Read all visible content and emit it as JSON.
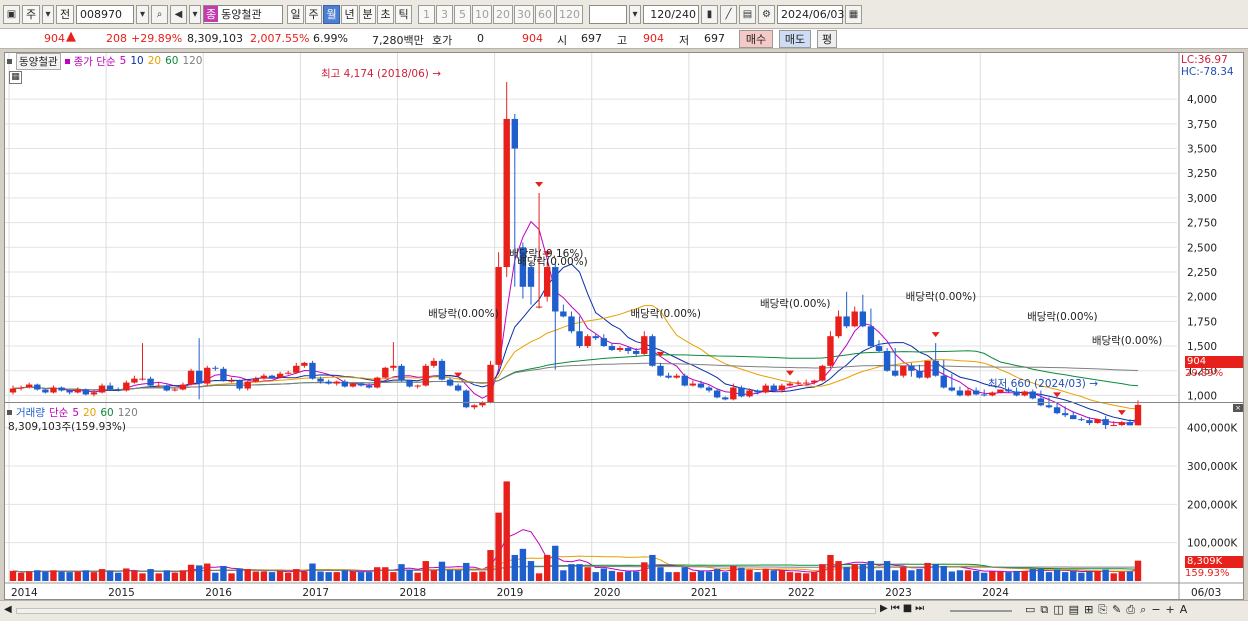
{
  "toolbar": {
    "type_label": "주",
    "prev_label": "전",
    "code": "008970",
    "stock_badge": "종",
    "stock_name": "동양철관",
    "periods": [
      "일",
      "주",
      "월",
      "년",
      "분",
      "초",
      "틱"
    ],
    "active_period": "월",
    "ticks": [
      "1",
      "3",
      "5",
      "10",
      "20",
      "30",
      "60",
      "120"
    ],
    "count": "120",
    "count_total": "/240",
    "date": "2024/06/03"
  },
  "quote": {
    "price": "904",
    "change": "208",
    "change_pct": "+29.89%",
    "volume": "8,309,103",
    "volume_pct": "2,007.55%",
    "turnover": "6.99%",
    "amount": "7,280백만",
    "hoga_label": "호가",
    "hoga_value": "0",
    "hoga_price": "904",
    "open_label": "시",
    "open": "697",
    "high_label": "고",
    "high": "904",
    "low_label": "저",
    "low": "697",
    "buy_label": "매수",
    "sell_label": "매도",
    "eval_label": "평"
  },
  "colors": {
    "up": "#e8201b",
    "down": "#1f5fcd",
    "ma5": "#c000c0",
    "ma10": "#0a2ea8",
    "ma20": "#e8a000",
    "ma60": "#0d8a3a",
    "ma120": "#808080"
  },
  "price_panel": {
    "stock_name": "동양철관",
    "legend_prefix": "종가 단순",
    "ma_labels": [
      "5",
      "10",
      "20",
      "60",
      "120"
    ],
    "lc": "LC:36.97",
    "hc": "HC:-78.34",
    "high_note": "최고 4,174 (2018/06)",
    "low_note": "최저 660 (2024/03)",
    "dividend_notes": [
      "배당락(0.00%)",
      "배당락(-9.16%)",
      "배당락(0.00%)",
      "배당락(0.00%)",
      "배당락(0.00%)",
      "배당락(0.00%)",
      "배당락(0.00%)",
      "배당락(0.00%)"
    ],
    "y_ticks": [
      "4,000",
      "3,750",
      "3,500",
      "3,250",
      "3,000",
      "2,750",
      "2,500",
      "2,250",
      "2,000",
      "1,750",
      "1,500",
      "1,250",
      "1,000"
    ],
    "cur_price": "904",
    "cur_pct": "29.89%"
  },
  "volume_panel": {
    "legend_label": "거래량",
    "legend_prefix": "단순",
    "ma_labels": [
      "5",
      "20",
      "60",
      "120"
    ],
    "current": "8,309,103주(159.93%)",
    "y_ticks": [
      "400,000K",
      "300,000K",
      "200,000K",
      "100,000K"
    ],
    "cur_vol": "8,309K",
    "cur_pct": "159.93%"
  },
  "x_axis": [
    "2014",
    "2015",
    "2016",
    "2017",
    "2018",
    "2019",
    "2020",
    "2021",
    "2022",
    "2023",
    "2024",
    "06/03"
  ],
  "chart_data": {
    "type": "candlestick",
    "x_start": "2014/01",
    "interval": "month",
    "open": [
      1030,
      1070,
      1080,
      1110,
      1060,
      1030,
      1080,
      1050,
      1030,
      1060,
      1010,
      1030,
      1100,
      1060,
      1050,
      1130,
      1170,
      1170,
      1100,
      1100,
      1050,
      1060,
      1110,
      1250,
      1120,
      1280,
      1270,
      1150,
      1150,
      1070,
      1140,
      1170,
      1200,
      1180,
      1220,
      1230,
      1300,
      1330,
      1170,
      1140,
      1120,
      1140,
      1090,
      1120,
      1100,
      1080,
      1180,
      1280,
      1300,
      1150,
      1090,
      1100,
      1300,
      1350,
      1160,
      1100,
      1050,
      880,
      900,
      930,
      1310,
      2300,
      3800,
      2500,
      2300,
      1900,
      2000,
      2300,
      1850,
      1800,
      1650,
      1500,
      1600,
      1580,
      1500,
      1460,
      1480,
      1450,
      1420,
      1600,
      1300,
      1200,
      1180,
      1200,
      1100,
      1120,
      1080,
      1050,
      980,
      960,
      1080,
      990,
      1050,
      1030,
      1100,
      1050,
      1100,
      1120,
      1130,
      1130,
      1150,
      1300,
      1600,
      1800,
      1700,
      1850,
      1700,
      1500,
      1450,
      1250,
      1200,
      1300,
      1250,
      1180,
      1350,
      1200,
      1080,
      1050,
      1000,
      1050,
      1010,
      1000,
      1030,
      1060,
      1040,
      1000,
      1040,
      970,
      900,
      880,
      820,
      800,
      760,
      750,
      720,
      760,
      700,
      700,
      730,
      697
    ],
    "close": [
      1070,
      1080,
      1110,
      1060,
      1030,
      1080,
      1050,
      1030,
      1060,
      1010,
      1030,
      1100,
      1060,
      1050,
      1130,
      1170,
      1170,
      1100,
      1100,
      1050,
      1060,
      1110,
      1250,
      1120,
      1280,
      1270,
      1150,
      1150,
      1070,
      1140,
      1170,
      1200,
      1180,
      1220,
      1230,
      1300,
      1330,
      1170,
      1140,
      1120,
      1140,
      1090,
      1120,
      1100,
      1080,
      1180,
      1280,
      1300,
      1150,
      1090,
      1100,
      1300,
      1350,
      1160,
      1100,
      1050,
      880,
      900,
      930,
      1310,
      2300,
      3800,
      3500,
      2100,
      2100,
      1900,
      2300,
      1850,
      1800,
      1650,
      1500,
      1600,
      1580,
      1500,
      1460,
      1480,
      1450,
      1420,
      1600,
      1300,
      1200,
      1180,
      1200,
      1100,
      1120,
      1080,
      1050,
      980,
      960,
      1080,
      990,
      1050,
      1030,
      1100,
      1050,
      1100,
      1120,
      1130,
      1130,
      1150,
      1300,
      1600,
      1800,
      1700,
      1850,
      1700,
      1500,
      1450,
      1250,
      1200,
      1300,
      1250,
      1180,
      1350,
      1200,
      1080,
      1050,
      1000,
      1050,
      1010,
      1000,
      1030,
      1060,
      1040,
      1000,
      1040,
      970,
      900,
      880,
      820,
      800,
      760,
      750,
      720,
      760,
      700,
      700,
      730,
      697,
      904
    ],
    "high": [
      1100,
      1100,
      1130,
      1120,
      1070,
      1100,
      1090,
      1060,
      1080,
      1070,
      1050,
      1120,
      1130,
      1080,
      1150,
      1200,
      1530,
      1190,
      1130,
      1110,
      1080,
      1130,
      1270,
      1580,
      1300,
      1300,
      1290,
      1180,
      1160,
      1150,
      1190,
      1220,
      1210,
      1240,
      1250,
      1330,
      1340,
      1350,
      1190,
      1160,
      1150,
      1160,
      1130,
      1130,
      1120,
      1190,
      1290,
      1540,
      1320,
      1160,
      1110,
      1320,
      1380,
      1370,
      1180,
      1120,
      1060,
      910,
      940,
      1350,
      2450,
      4174,
      3850,
      2550,
      2350,
      3050,
      2350,
      2350,
      1920,
      1850,
      1800,
      1620,
      1620,
      1620,
      1530,
      1500,
      1500,
      1480,
      1650,
      1620,
      1330,
      1230,
      1220,
      1220,
      1150,
      1150,
      1100,
      1070,
      990,
      1120,
      1100,
      1070,
      1060,
      1120,
      1120,
      1120,
      1140,
      1150,
      1160,
      1160,
      1310,
      1650,
      1860,
      2050,
      1900,
      2020,
      1880,
      1560,
      1480,
      1480,
      1240,
      1330,
      1310,
      1270,
      1530,
      1360,
      1220,
      1090,
      1070,
      1080,
      1060,
      1040,
      1060,
      1080,
      1080,
      1050,
      1060,
      1050,
      980,
      920,
      890,
      840,
      780,
      780,
      760,
      790,
      740,
      740,
      760,
      950
    ],
    "low": [
      1010,
      1050,
      1070,
      1050,
      1020,
      1020,
      1040,
      1010,
      1020,
      1000,
      990,
      1020,
      1050,
      1040,
      1040,
      1120,
      1150,
      1090,
      1080,
      1040,
      1040,
      1050,
      1100,
      960,
      1100,
      1250,
      1140,
      1130,
      1050,
      1050,
      1130,
      1160,
      1170,
      1170,
      1210,
      1220,
      1280,
      1160,
      1120,
      1110,
      1100,
      1080,
      1080,
      1090,
      1070,
      1070,
      1170,
      1250,
      1140,
      1080,
      1070,
      1090,
      1280,
      1150,
      1090,
      1040,
      870,
      860,
      880,
      920,
      1280,
      2200,
      2100,
      1980,
      1920,
      1880,
      1950,
      1260,
      1790,
      1630,
      1480,
      1480,
      1560,
      1490,
      1450,
      1440,
      1420,
      1400,
      1410,
      1290,
      1190,
      1170,
      1170,
      1090,
      1090,
      1070,
      1030,
      970,
      950,
      950,
      980,
      980,
      1010,
      1020,
      1040,
      1030,
      1090,
      1100,
      1110,
      1110,
      1140,
      1280,
      1580,
      1680,
      1690,
      1690,
      1480,
      1440,
      1240,
      1190,
      1180,
      1190,
      1170,
      1170,
      1190,
      1070,
      1040,
      990,
      990,
      1000,
      990,
      990,
      1020,
      1030,
      990,
      990,
      960,
      890,
      870,
      810,
      780,
      760,
      740,
      700,
      715,
      660,
      690,
      690,
      697,
      697
    ]
  }
}
